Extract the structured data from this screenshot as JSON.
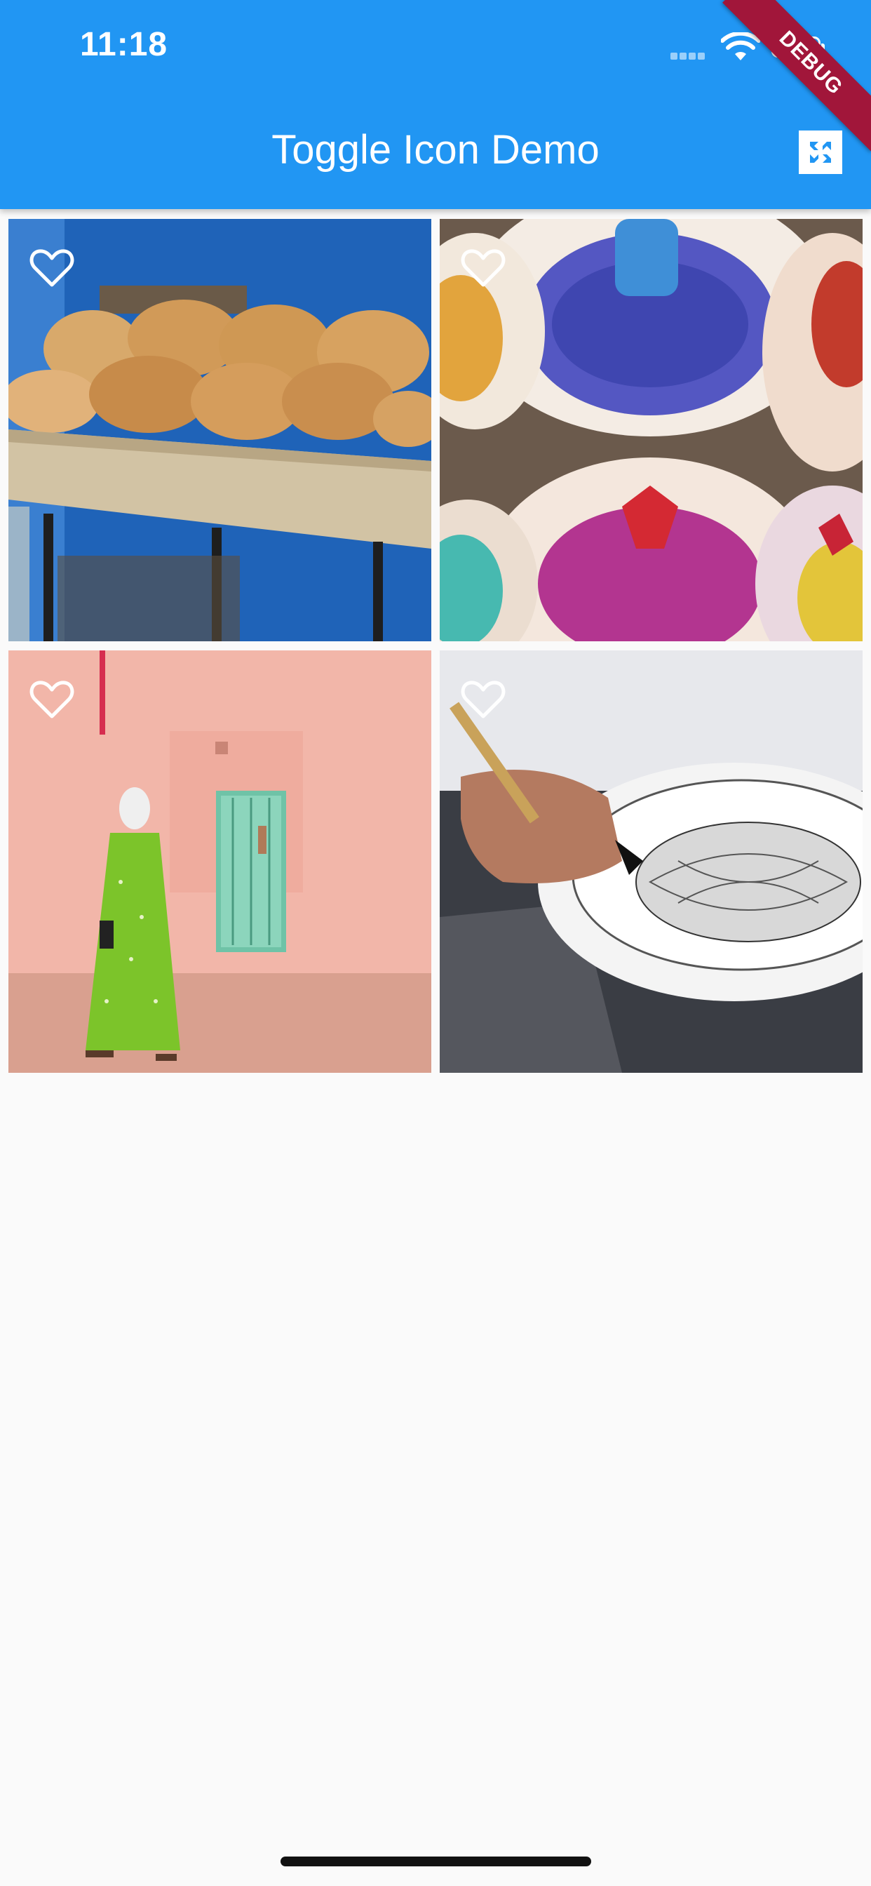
{
  "status_bar": {
    "time": "11:18"
  },
  "app_bar": {
    "title": "Toggle Icon Demo",
    "action_icon": "fullscreen-icon"
  },
  "debug_banner": "DEBUG",
  "grid": {
    "tiles": [
      {
        "photo": "bread-cart-photo",
        "favorite_icon": "heart-outline-icon",
        "favorited": false
      },
      {
        "photo": "spice-bags-photo",
        "favorite_icon": "heart-outline-icon",
        "favorited": false
      },
      {
        "photo": "pink-wall-woman-photo",
        "favorite_icon": "heart-outline-icon",
        "favorited": false
      },
      {
        "photo": "ceramic-plate-painting-photo",
        "favorite_icon": "heart-outline-icon",
        "favorited": false
      }
    ]
  },
  "colors": {
    "app_bar": "#2196F3",
    "background": "#FAFAFA",
    "debug_banner": "#A1163A"
  }
}
